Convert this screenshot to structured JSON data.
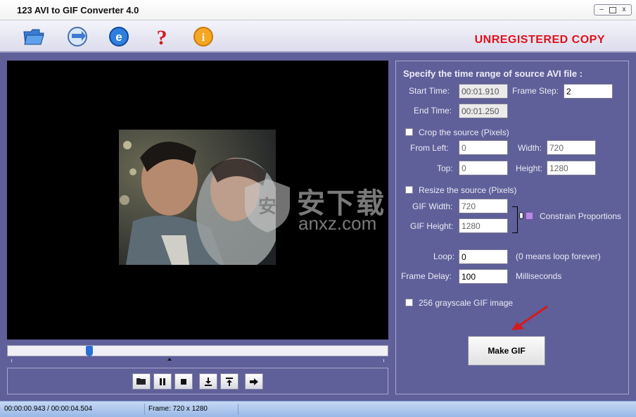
{
  "window": {
    "title": "123 AVI to GIF Converter 4.0",
    "minimize": "▭",
    "maximize": "□",
    "close": "x"
  },
  "toolbar": {
    "icons": [
      "open-folder-icon",
      "convert-icon",
      "web-icon",
      "help-icon",
      "info-icon"
    ],
    "unregistered": "UNREGISTERED COPY"
  },
  "video": {
    "watermark_cn": "安下载",
    "watermark_sub": "anxz.com",
    "watermark_mark": "安"
  },
  "seek": {
    "position_fraction": 0.209
  },
  "controls": [
    "open-file-icon",
    "pause-icon",
    "stop-icon",
    "set-start-icon",
    "set-end-icon",
    "next-icon"
  ],
  "settings": {
    "header": "Specify the time range of source AVI file :",
    "start_time_label": "Start Time:",
    "start_time": "00:01.910",
    "frame_step_label": "Frame Step:",
    "frame_step": "2",
    "end_time_label": "End Time:",
    "end_time": "00:01.250",
    "crop_label": "Crop the source  (Pixels)",
    "from_left_label": "From  Left:",
    "from_left": "0",
    "width_label": "Width:",
    "width": "720",
    "top_label": "Top:",
    "top": "0",
    "height_label": "Height:",
    "height": "1280",
    "resize_label": "Resize the source  (Pixels)",
    "gif_width_label": "GIF Width:",
    "gif_width": "720",
    "gif_height_label": "GIF Height:",
    "gif_height": "1280",
    "constrain_label": "Constrain Proportions",
    "loop_label": "Loop:",
    "loop": "0",
    "loop_note": "(0 means loop forever)",
    "frame_delay_label": "Frame Delay:",
    "frame_delay": "100",
    "frame_delay_unit": "Milliseconds",
    "grayscale_label": "256 grayscale GIF image",
    "make_gif": "Make GIF",
    "crop_checked": false,
    "resize_checked": false,
    "constrain_checked": true,
    "grayscale_checked": false
  },
  "status": {
    "time": "00:00:00.943 / 00:00:04.504",
    "frame": "Frame: 720 x 1280"
  },
  "colors": {
    "panel_bg": "#5f5f99",
    "accent_red": "#e0101a",
    "seek_thumb": "#2a6fd6"
  }
}
